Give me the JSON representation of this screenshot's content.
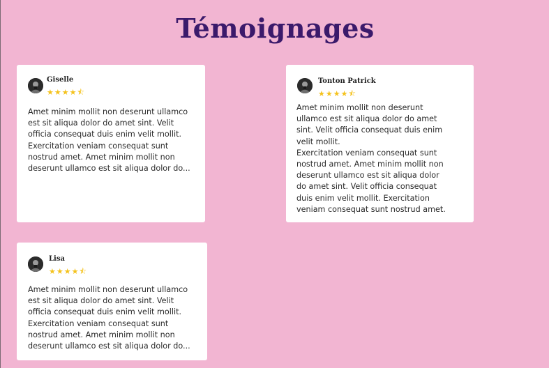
{
  "page": {
    "title": "Témoignages"
  },
  "colors": {
    "background": "#f2b5d2",
    "title": "#3b1a6b",
    "star": "#f4c21c",
    "card": "#ffffff"
  },
  "testimonials": [
    {
      "name": "Giselle",
      "stars": "★★★★⯪",
      "rating": 4.5,
      "avatar_icon": "user-avatar-icon",
      "text": "Amet minim mollit non deserunt ullamco\nest sit aliqua dolor do amet sint. Velit\nofficia consequat duis enim velit mollit.\nExercitation veniam consequat sunt\nnostrud amet. Amet minim mollit non\ndeserunt ullamco est sit aliqua dolor do..."
    },
    {
      "name": "Tonton Patrick",
      "stars": "★★★★⯪",
      "rating": 4.5,
      "avatar_icon": "user-avatar-icon",
      "text": "Amet minim mollit non deserunt\nullamco est sit aliqua dolor do amet\nsint. Velit officia consequat duis enim\nvelit mollit.\nExercitation veniam consequat sunt\nnostrud amet. Amet minim mollit non\ndeserunt ullamco est sit aliqua dolor\ndo amet sint. Velit officia consequat\nduis enim velit mollit. Exercitation\nveniam consequat sunt nostrud amet."
    },
    {
      "name": "Lisa",
      "stars": "★★★★⯪",
      "rating": 4.5,
      "avatar_icon": "user-avatar-icon",
      "text": "Amet minim mollit non deserunt ullamco\nest sit aliqua dolor do amet sint. Velit\nofficia consequat duis enim velit mollit.\nExercitation veniam consequat sunt\nnostrud amet. Amet minim mollit non\ndeserunt ullamco est sit aliqua dolor do..."
    }
  ]
}
